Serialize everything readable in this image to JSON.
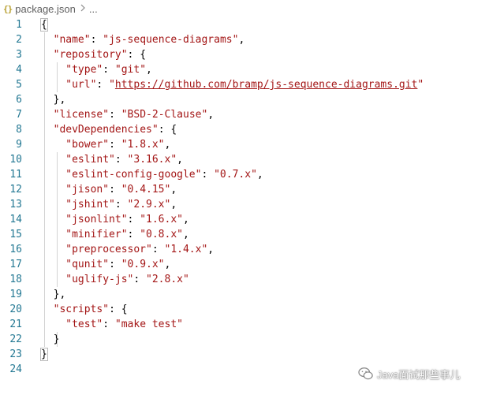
{
  "breadcrumb": {
    "file_icon": "{}",
    "file_name": "package.json",
    "separator_icon": "chevron-right-icon",
    "more": "..."
  },
  "colors": {
    "line_number": "#237893",
    "string_and_key": "#a31515",
    "punctuation": "#000000"
  },
  "lines": [
    {
      "num": "1",
      "tokens": [
        {
          "t": "punc",
          "v": "{"
        }
      ]
    },
    {
      "num": "2",
      "tokens": [
        {
          "t": "key",
          "v": "\"name\""
        },
        {
          "t": "punc",
          "v": ": "
        },
        {
          "t": "str",
          "v": "\"js-sequence-diagrams\""
        },
        {
          "t": "punc",
          "v": ","
        }
      ]
    },
    {
      "num": "3",
      "tokens": [
        {
          "t": "key",
          "v": "\"repository\""
        },
        {
          "t": "punc",
          "v": ": {"
        }
      ]
    },
    {
      "num": "4",
      "tokens": [
        {
          "t": "key",
          "v": "\"type\""
        },
        {
          "t": "punc",
          "v": ": "
        },
        {
          "t": "str",
          "v": "\"git\""
        },
        {
          "t": "punc",
          "v": ","
        }
      ]
    },
    {
      "num": "5",
      "tokens": [
        {
          "t": "key",
          "v": "\"url\""
        },
        {
          "t": "punc",
          "v": ": "
        },
        {
          "t": "str",
          "v": "\""
        },
        {
          "t": "url",
          "v": "https://github.com/bramp/js-sequence-diagrams.git"
        },
        {
          "t": "str",
          "v": "\""
        }
      ]
    },
    {
      "num": "6",
      "tokens": [
        {
          "t": "punc",
          "v": "},"
        }
      ]
    },
    {
      "num": "7",
      "tokens": [
        {
          "t": "key",
          "v": "\"license\""
        },
        {
          "t": "punc",
          "v": ": "
        },
        {
          "t": "str",
          "v": "\"BSD-2-Clause\""
        },
        {
          "t": "punc",
          "v": ","
        }
      ]
    },
    {
      "num": "8",
      "tokens": [
        {
          "t": "key",
          "v": "\"devDependencies\""
        },
        {
          "t": "punc",
          "v": ": {"
        }
      ]
    },
    {
      "num": "9",
      "tokens": [
        {
          "t": "key",
          "v": "\"bower\""
        },
        {
          "t": "punc",
          "v": ": "
        },
        {
          "t": "str",
          "v": "\"1.8.x\""
        },
        {
          "t": "punc",
          "v": ","
        }
      ]
    },
    {
      "num": "10",
      "tokens": [
        {
          "t": "key",
          "v": "\"eslint\""
        },
        {
          "t": "punc",
          "v": ": "
        },
        {
          "t": "str",
          "v": "\"3.16.x\""
        },
        {
          "t": "punc",
          "v": ","
        }
      ]
    },
    {
      "num": "11",
      "tokens": [
        {
          "t": "key",
          "v": "\"eslint-config-google\""
        },
        {
          "t": "punc",
          "v": ": "
        },
        {
          "t": "str",
          "v": "\"0.7.x\""
        },
        {
          "t": "punc",
          "v": ","
        }
      ]
    },
    {
      "num": "12",
      "tokens": [
        {
          "t": "key",
          "v": "\"jison\""
        },
        {
          "t": "punc",
          "v": ": "
        },
        {
          "t": "str",
          "v": "\"0.4.15\""
        },
        {
          "t": "punc",
          "v": ","
        }
      ]
    },
    {
      "num": "13",
      "tokens": [
        {
          "t": "key",
          "v": "\"jshint\""
        },
        {
          "t": "punc",
          "v": ": "
        },
        {
          "t": "str",
          "v": "\"2.9.x\""
        },
        {
          "t": "punc",
          "v": ","
        }
      ]
    },
    {
      "num": "14",
      "tokens": [
        {
          "t": "key",
          "v": "\"jsonlint\""
        },
        {
          "t": "punc",
          "v": ": "
        },
        {
          "t": "str",
          "v": "\"1.6.x\""
        },
        {
          "t": "punc",
          "v": ","
        }
      ]
    },
    {
      "num": "15",
      "tokens": [
        {
          "t": "key",
          "v": "\"minifier\""
        },
        {
          "t": "punc",
          "v": ": "
        },
        {
          "t": "str",
          "v": "\"0.8.x\""
        },
        {
          "t": "punc",
          "v": ","
        }
      ]
    },
    {
      "num": "16",
      "tokens": [
        {
          "t": "key",
          "v": "\"preprocessor\""
        },
        {
          "t": "punc",
          "v": ": "
        },
        {
          "t": "str",
          "v": "\"1.4.x\""
        },
        {
          "t": "punc",
          "v": ","
        }
      ]
    },
    {
      "num": "17",
      "tokens": [
        {
          "t": "key",
          "v": "\"qunit\""
        },
        {
          "t": "punc",
          "v": ": "
        },
        {
          "t": "str",
          "v": "\"0.9.x\""
        },
        {
          "t": "punc",
          "v": ","
        }
      ]
    },
    {
      "num": "18",
      "tokens": [
        {
          "t": "key",
          "v": "\"uglify-js\""
        },
        {
          "t": "punc",
          "v": ": "
        },
        {
          "t": "str",
          "v": "\"2.8.x\""
        }
      ]
    },
    {
      "num": "19",
      "tokens": [
        {
          "t": "punc",
          "v": "},"
        }
      ]
    },
    {
      "num": "20",
      "tokens": [
        {
          "t": "key",
          "v": "\"scripts\""
        },
        {
          "t": "punc",
          "v": ": {"
        }
      ]
    },
    {
      "num": "21",
      "tokens": [
        {
          "t": "key",
          "v": "\"test\""
        },
        {
          "t": "punc",
          "v": ": "
        },
        {
          "t": "str",
          "v": "\"make test\""
        }
      ]
    },
    {
      "num": "22",
      "tokens": [
        {
          "t": "punc",
          "v": "}"
        }
      ]
    },
    {
      "num": "23",
      "tokens": [
        {
          "t": "punc",
          "v": "}"
        }
      ]
    },
    {
      "num": "24",
      "tokens": []
    }
  ],
  "watermark": {
    "icon": "wechat-icon",
    "text": "Java面试那些事儿"
  }
}
